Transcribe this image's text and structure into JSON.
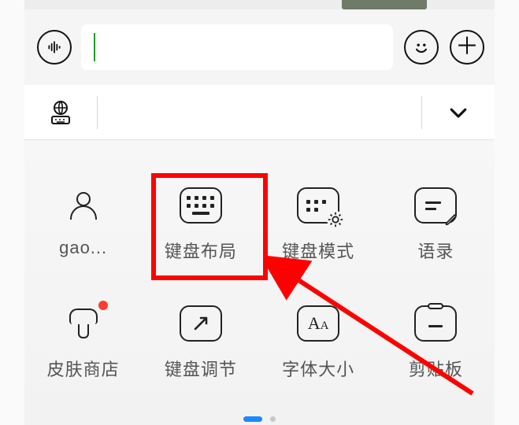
{
  "input_bar": {
    "voice_icon": "sound-waves-icon",
    "emoji_icon": "smile-icon",
    "plus_icon": "plus-icon",
    "text_value": ""
  },
  "suggestion_row": {
    "left_icon": "globe-keyboard-icon",
    "toggle_icon": "chevron-down-icon"
  },
  "tool_grid": {
    "items": [
      {
        "label": "gao...",
        "icon": "person-icon",
        "boxed": false
      },
      {
        "label": "键盘布局",
        "icon": "keyboard-dots-icon",
        "boxed": true
      },
      {
        "label": "键盘模式",
        "icon": "keyboard-gear-icon",
        "boxed": true
      },
      {
        "label": "语录",
        "icon": "note-edit-icon",
        "boxed": true
      },
      {
        "label": "皮肤商店",
        "icon": "brush-icon",
        "boxed": false,
        "badge": true
      },
      {
        "label": "键盘调节",
        "icon": "resize-icon",
        "boxed": true
      },
      {
        "label": "字体大小",
        "icon": "font-size-icon",
        "boxed": true
      },
      {
        "label": "剪贴板",
        "icon": "clipboard-icon",
        "boxed": true
      }
    ]
  },
  "pager": {
    "active": 0,
    "count": 2
  },
  "annotation": {
    "highlight_target": "键盘布局",
    "arrow": true
  }
}
